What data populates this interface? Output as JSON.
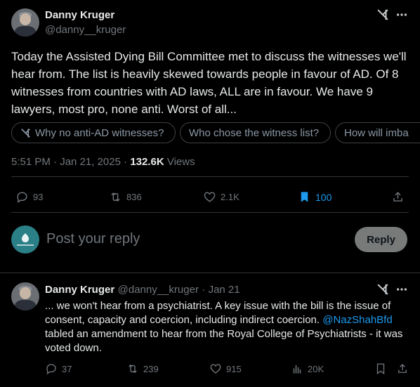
{
  "main_tweet": {
    "author_name": "Danny Kruger",
    "author_handle": "@danny__kruger",
    "text": "Today the Assisted Dying Bill Committee met to discuss the witnesses we'll hear from. The list is heavily skewed towards people in favour of AD. Of 8 witnesses from countries with AD laws, ALL are in favour. We have 9 lawyers, most pro, none anti. Worst of all...",
    "grok_prompts": [
      "Why no anti-AD witnesses?",
      "Who chose the witness list?",
      "How will imba"
    ],
    "time": "5:51 PM",
    "date": "Jan 21, 2025",
    "views_count": "132.6K",
    "views_label": "Views",
    "replies": "93",
    "reposts": "836",
    "likes": "2.1K",
    "bookmarks": "100"
  },
  "reply_box": {
    "placeholder": "Post your reply",
    "button_label": "Reply"
  },
  "reply_tweet": {
    "author_name": "Danny Kruger",
    "author_handle": "@danny__kruger",
    "date": "Jan 21",
    "text_before": "... we won't hear from a psychiatrist. A key issue with the bill is the issue of consent, capacity and coercion, including indirect coercion. ",
    "mention": "@NazShahBfd",
    "text_after": " tabled an amendment to hear from the Royal College of Psychiatrists - it was voted down.",
    "replies": "37",
    "reposts": "239",
    "likes": "915",
    "views": "20K"
  },
  "colors": {
    "background": "#000000",
    "text": "#e7e9ea",
    "muted": "#71767b",
    "accent": "#1d9bf0",
    "divider": "#2f3336"
  }
}
